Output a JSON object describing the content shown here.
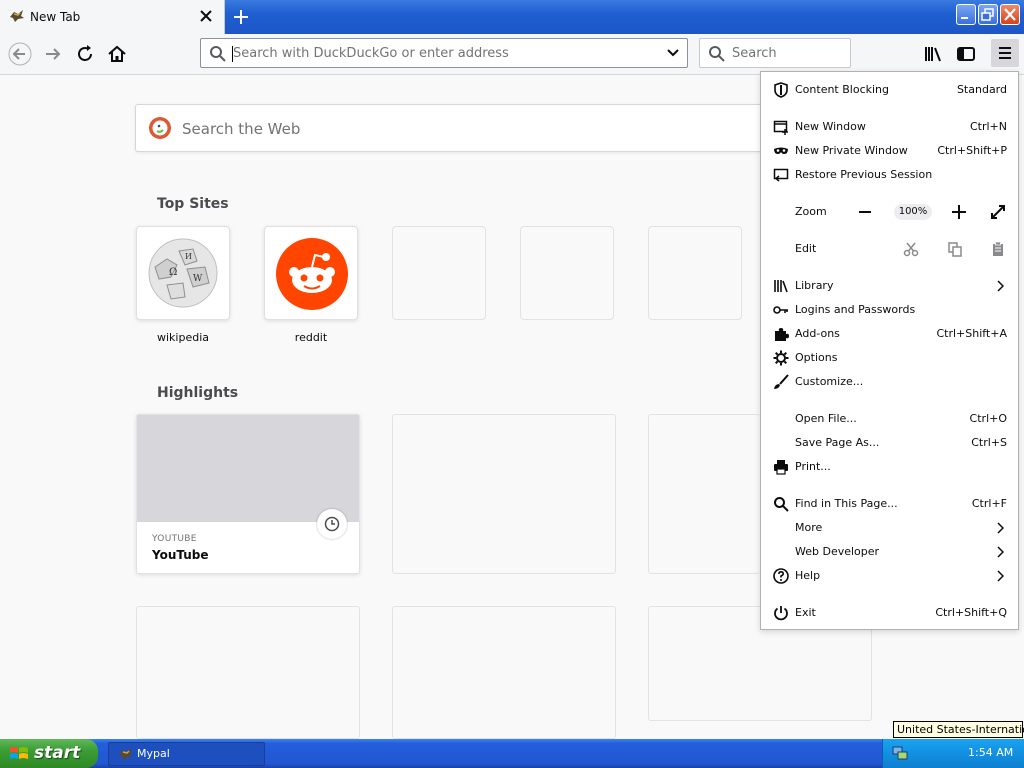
{
  "tab": {
    "title": "New Tab"
  },
  "navbar": {
    "url_placeholder": "Search with DuckDuckGo or enter address",
    "search_placeholder": "Search"
  },
  "content": {
    "web_search_placeholder": "Search the Web",
    "top_sites_title": "Top Sites",
    "top_sites": [
      {
        "label": "wikipedia"
      },
      {
        "label": "reddit"
      }
    ],
    "highlights_title": "Highlights",
    "highlight_card": {
      "source": "YOUTUBE",
      "title": "YouTube"
    }
  },
  "menu": {
    "items": [
      {
        "label": "Content Blocking",
        "shortcut": "Standard",
        "icon": "shield-icon"
      },
      {
        "label": "New Window",
        "shortcut": "Ctrl+N",
        "icon": "new-window-icon"
      },
      {
        "label": "New Private Window",
        "shortcut": "Ctrl+Shift+P",
        "icon": "private-mask-icon"
      },
      {
        "label": "Restore Previous Session",
        "shortcut": "",
        "icon": "restore-session-icon"
      },
      {
        "label": "Zoom",
        "zoom_value": "100%"
      },
      {
        "label": "Edit"
      },
      {
        "label": "Library",
        "icon": "library-icon"
      },
      {
        "label": "Logins and Passwords",
        "icon": "key-icon"
      },
      {
        "label": "Add-ons",
        "shortcut": "Ctrl+Shift+A",
        "icon": "puzzle-icon"
      },
      {
        "label": "Options",
        "icon": "gear-icon"
      },
      {
        "label": "Customize...",
        "icon": "paintbrush-icon"
      },
      {
        "label": "Open File...",
        "shortcut": "Ctrl+O"
      },
      {
        "label": "Save Page As...",
        "shortcut": "Ctrl+S"
      },
      {
        "label": "Print...",
        "icon": "printer-icon"
      },
      {
        "label": "Find in This Page...",
        "shortcut": "Ctrl+F",
        "icon": "search-icon"
      },
      {
        "label": "More"
      },
      {
        "label": "Web Developer"
      },
      {
        "label": "Help",
        "icon": "help-icon"
      },
      {
        "label": "Exit",
        "shortcut": "Ctrl+Shift+Q",
        "icon": "power-icon"
      }
    ]
  },
  "taskbar": {
    "start_label": "start",
    "window_label": "Mypal",
    "clock": "1:54 AM",
    "tooltip": "United States-International"
  }
}
